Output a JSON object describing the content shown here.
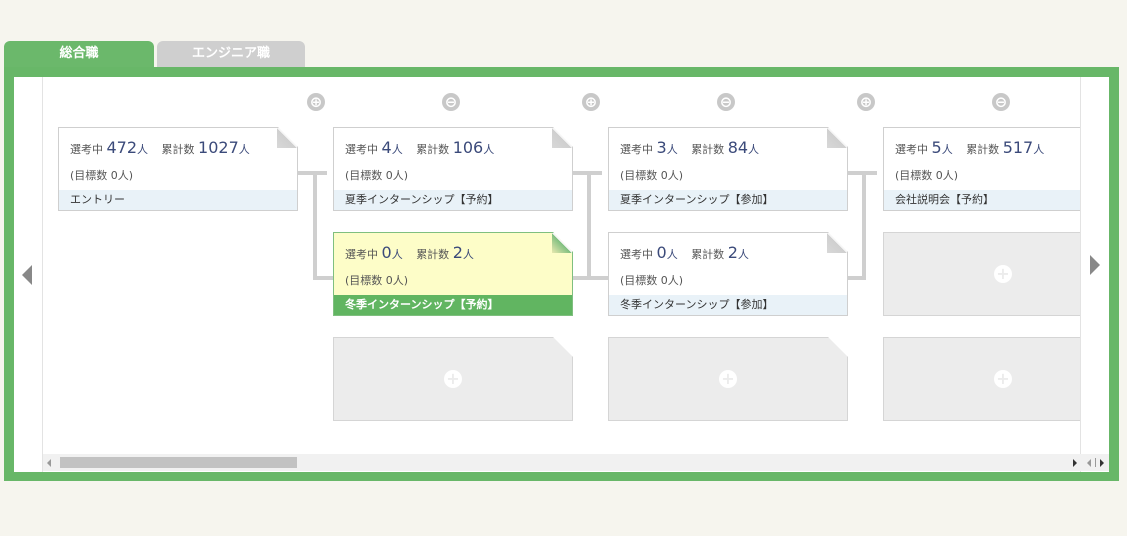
{
  "tabs": [
    {
      "label": "総合職",
      "active": true
    },
    {
      "label": "エンジニア職",
      "active": false
    }
  ],
  "columns": [
    {
      "toggle": "⊕"
    },
    {
      "toggle": "⊖"
    },
    {
      "toggle": "⊕"
    },
    {
      "toggle": "⊖"
    },
    {
      "toggle": "⊕"
    },
    {
      "toggle": "⊖"
    }
  ],
  "labels": {
    "in_selection": "選考中",
    "cumulative": "累計数",
    "unit": "人"
  },
  "cards": [
    {
      "in_selection": "472",
      "cumulative": "1027",
      "target": "(目標数 0人)",
      "label": "エントリー"
    },
    {
      "in_selection": "4",
      "cumulative": "106",
      "target": "(目標数 0人)",
      "label": "夏季インターンシップ【予約】"
    },
    {
      "in_selection": "0",
      "cumulative": "2",
      "target": "(目標数 0人)",
      "label": "冬季インターンシップ【予約】",
      "highlight": true
    },
    {
      "in_selection": "3",
      "cumulative": "84",
      "target": "(目標数 0人)",
      "label": "夏季インターンシップ【参加】"
    },
    {
      "in_selection": "0",
      "cumulative": "2",
      "target": "(目標数 0人)",
      "label": "冬季インターンシップ【参加】"
    },
    {
      "in_selection": "5",
      "cumulative": "517",
      "target": "(目標数 0人)",
      "label": "会社説明会【予約】"
    }
  ],
  "colors": {
    "accent_green": "#68b768",
    "highlight_yellow": "#fdfdc8",
    "number_blue": "#3b4a7a"
  },
  "icons": {
    "expand": "plus-circle-icon",
    "collapse": "minus-circle-icon",
    "add": "add-step-icon",
    "nav_prev": "arrow-left-icon",
    "nav_next": "arrow-right-icon"
  }
}
